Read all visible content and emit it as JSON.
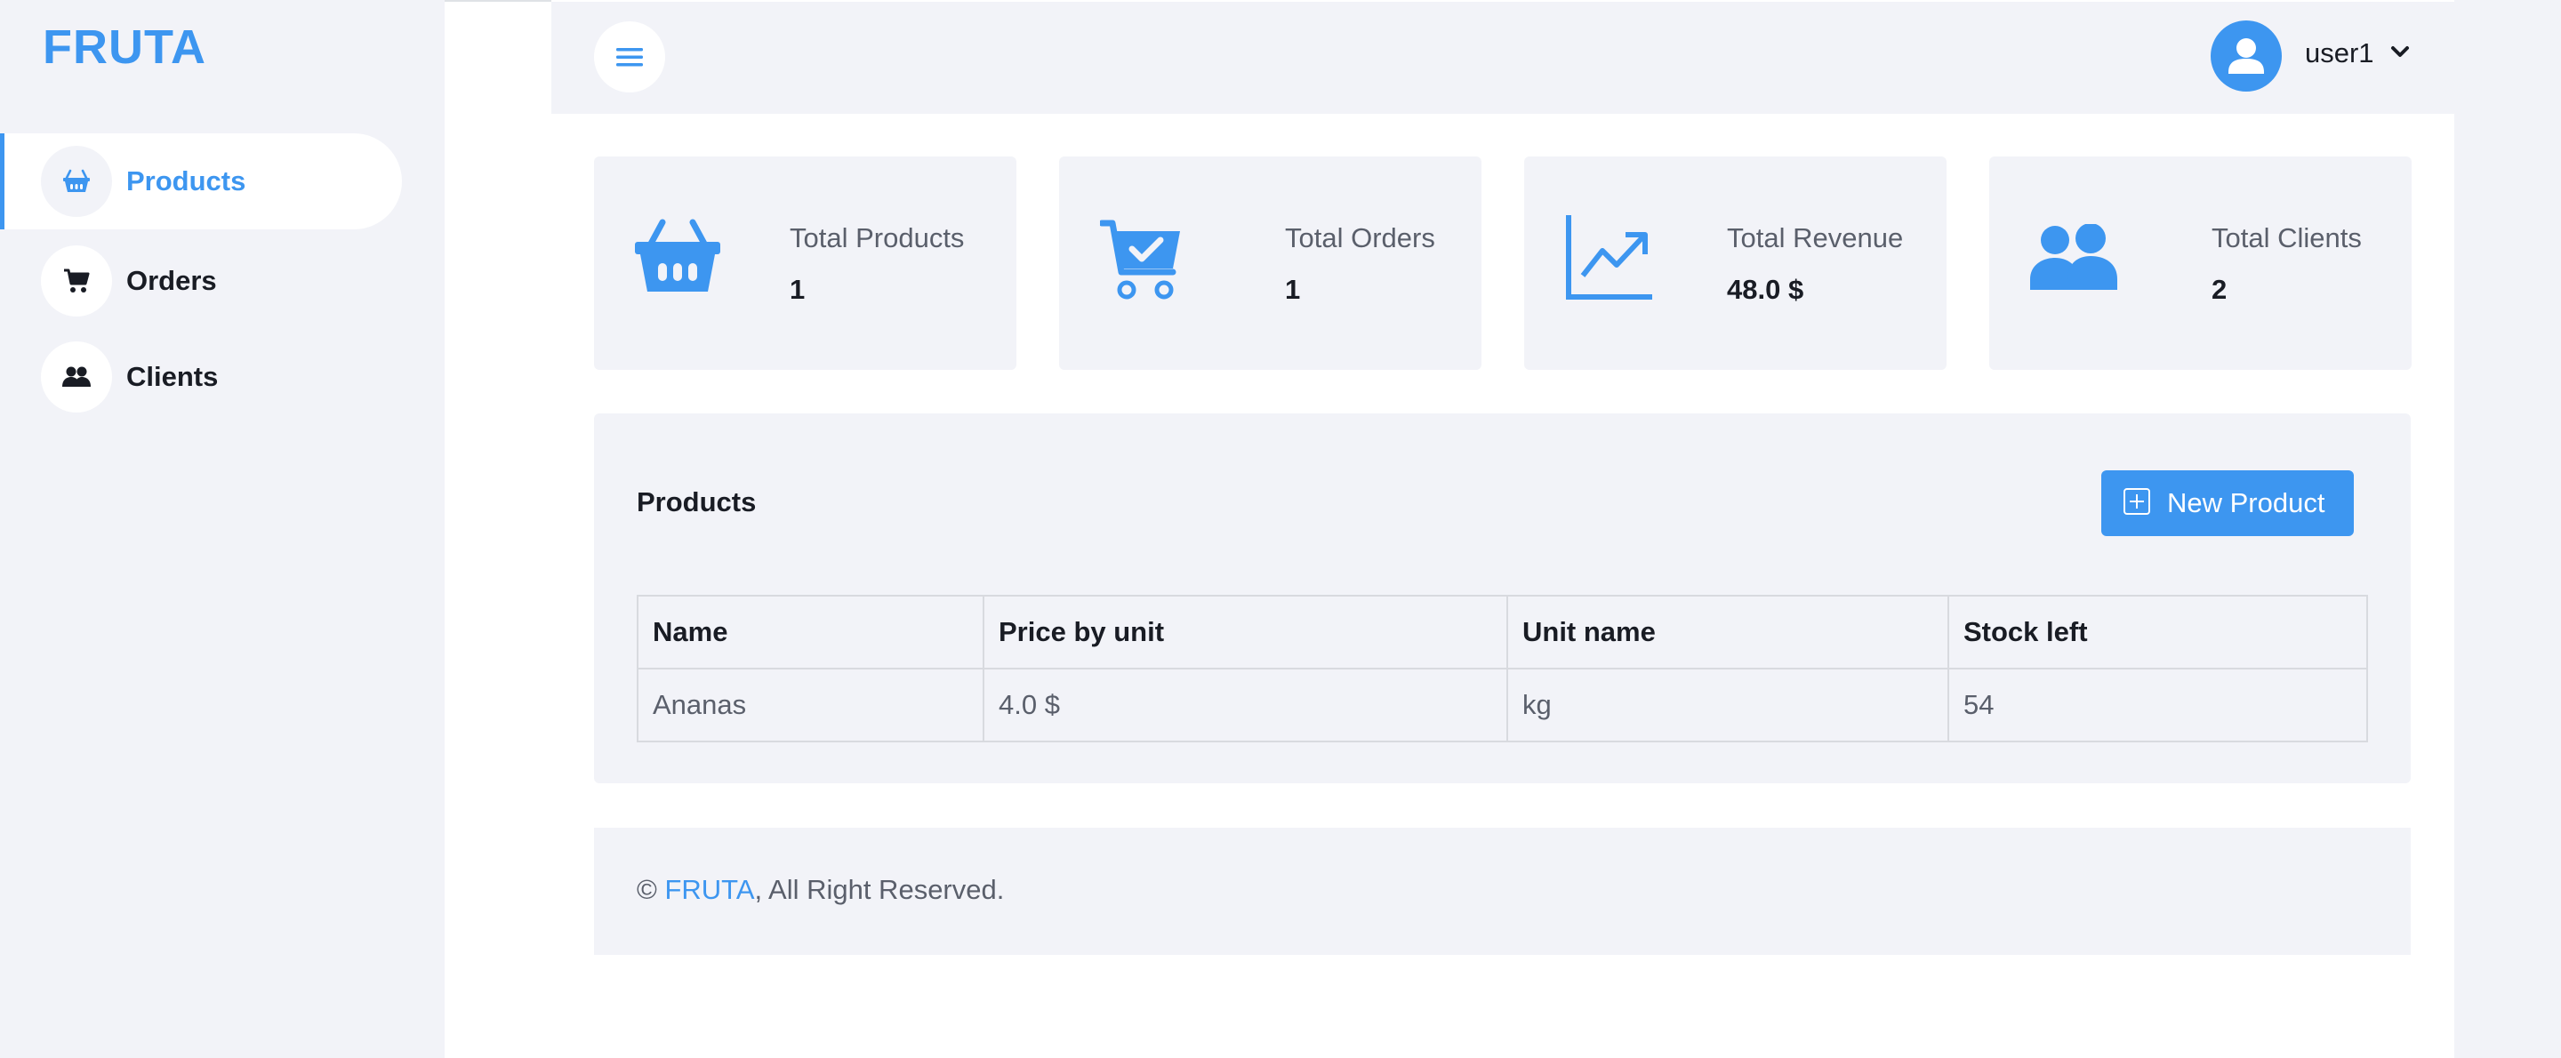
{
  "brand": {
    "name": "FRUTA",
    "accent": "#3d96f0"
  },
  "sidebar": {
    "items": [
      {
        "label": "Products",
        "icon": "basket-icon",
        "active": true
      },
      {
        "label": "Orders",
        "icon": "cart-icon",
        "active": false
      },
      {
        "label": "Clients",
        "icon": "users-icon",
        "active": false
      }
    ]
  },
  "header": {
    "menu_icon": "hamburger-menu-icon",
    "user": {
      "name": "user1",
      "avatar_icon": "user-avatar-icon",
      "dropdown_icon": "chevron-down-icon"
    }
  },
  "stats": [
    {
      "title": "Total Products",
      "value": "1",
      "icon": "basket-icon"
    },
    {
      "title": "Total Orders",
      "value": "1",
      "icon": "cart-check-icon"
    },
    {
      "title": "Total Revenue",
      "value": "48.0 $",
      "icon": "chart-line-icon"
    },
    {
      "title": "Total Clients",
      "value": "2",
      "icon": "users-icon"
    }
  ],
  "products_panel": {
    "title": "Products",
    "new_button": "New Product",
    "columns": [
      "Name",
      "Price by unit",
      "Unit name",
      "Stock left"
    ],
    "rows": [
      [
        "Ananas",
        "4.0 $",
        "kg",
        "54"
      ]
    ]
  },
  "footer": {
    "copyright": "©",
    "brand": "FRUTA",
    "text": ", All Right Reserved."
  }
}
